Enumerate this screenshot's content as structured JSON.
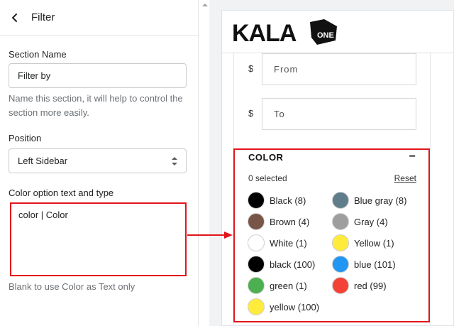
{
  "panel": {
    "title": "Filter",
    "section_name_label": "Section Name",
    "section_name_value": "Filter by",
    "section_name_help": "Name this section, it will help to control the section more easily.",
    "position_label": "Position",
    "position_value": "Left Sidebar",
    "color_option_label": "Color option text and type",
    "color_option_value": "color | Color",
    "color_option_help": "Blank to use Color as Text only"
  },
  "store": {
    "logo_text": "KALA",
    "logo_badge": "ONE",
    "price_from_symbol": "$",
    "price_from_placeholder": "From",
    "price_to_symbol": "$",
    "price_to_placeholder": "To",
    "color_filter": {
      "title": "COLOR",
      "collapse_symbol": "−",
      "selected_text": "0 selected",
      "reset_label": "Reset",
      "swatches": [
        {
          "label": "Black (8)",
          "color": "#000000"
        },
        {
          "label": "Blue gray (8)",
          "color": "#607d8b"
        },
        {
          "label": "Brown (4)",
          "color": "#795548"
        },
        {
          "label": "Gray (4)",
          "color": "#9e9e9e"
        },
        {
          "label": "White (1)",
          "color": "#ffffff"
        },
        {
          "label": "Yellow (1)",
          "color": "#ffeb3b"
        },
        {
          "label": "black (100)",
          "color": "#000000"
        },
        {
          "label": "blue (101)",
          "color": "#2196f3"
        },
        {
          "label": "green (1)",
          "color": "#4caf50"
        },
        {
          "label": "red (99)",
          "color": "#f44336"
        },
        {
          "label": "yellow (100)",
          "color": "#ffeb3b"
        }
      ]
    }
  },
  "colors": {
    "highlight": "#e3141a",
    "accent_text": "#202223"
  }
}
